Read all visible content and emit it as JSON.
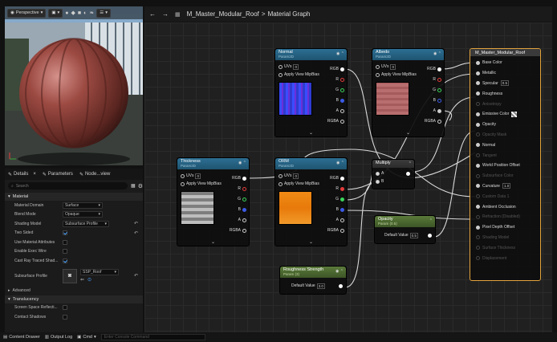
{
  "viewport": {
    "mode_label": "Perspective",
    "toolbar_icons": [
      "dropdown-icon",
      "camera-icon",
      "eye-icon",
      "pen-icon",
      "leaf-icon",
      "hamburger-icon"
    ]
  },
  "graph": {
    "breadcrumb_root": "M_Master_Modular_Roof",
    "breadcrumb_sep": ">",
    "breadcrumb_current": "Material Graph"
  },
  "details": {
    "tabs": [
      "Details",
      "Parameters",
      "Node...view"
    ],
    "search_placeholder": "Search",
    "sections": {
      "material": "Material",
      "advanced": "Advanced",
      "translucency": "Translucency"
    },
    "rows": [
      {
        "label": "Material Domain",
        "value": "Surface"
      },
      {
        "label": "Blend Mode",
        "value": "Opaque"
      },
      {
        "label": "Shading Model",
        "value": "Subsurface Profile"
      },
      {
        "label": "Two Sided"
      },
      {
        "label": "Use Material Attributes"
      },
      {
        "label": "Enable Exec Wire"
      },
      {
        "label": "Cast Ray Traced Shad..."
      },
      {
        "label": "Subsurface Profile",
        "value": "SSP_Roof"
      }
    ],
    "trans_rows": [
      "Screen Space Reflecti...",
      "Contact Shadows"
    ]
  },
  "bottom": {
    "content_drawer": "Content Drawer",
    "output_log": "Output Log",
    "cmd": "Cmd",
    "console_placeholder": "Enter Console Command"
  },
  "nodes": {
    "normal": {
      "title": "Normal",
      "sub": "Param2D",
      "uvs": "UVs",
      "uvs_val": "0",
      "mip": "Apply View MipBias",
      "pins": [
        "RGB",
        "R",
        "G",
        "B",
        "A",
        "RGBA"
      ]
    },
    "albedo": {
      "title": "Albedo",
      "sub": "Param2D",
      "uvs": "UVs",
      "uvs_val": "0",
      "mip": "Apply View MipBias",
      "pins": [
        "RGB",
        "R",
        "G",
        "B",
        "A",
        "RGBA"
      ]
    },
    "thickness": {
      "title": "Thickness",
      "sub": "Param2D",
      "uvs": "UVs",
      "uvs_val": "0",
      "mip": "Apply View MipBias",
      "pins": [
        "RGB",
        "R",
        "G",
        "B",
        "A",
        "RGBA"
      ]
    },
    "orm": {
      "title": "ORM",
      "sub": "Param2D",
      "uvs": "UVs",
      "uvs_val": "0",
      "mip": "Apply View MipBias",
      "pins": [
        "RGB",
        "R",
        "G",
        "B",
        "A",
        "RGBA"
      ]
    },
    "multiply": {
      "title": "Multiply",
      "a": "A",
      "b": "B"
    },
    "opacity": {
      "title": "Opacity",
      "sub": "Param (0.5)",
      "label": "Default Value",
      "value": "0.5"
    },
    "roughness": {
      "title": "Roughness Strength",
      "sub": "Param (3)",
      "label": "Default Value",
      "value": "3.0"
    }
  },
  "output_node": {
    "title": "M_Master_Modular_Roof",
    "pins": [
      {
        "label": "Base Color",
        "active": true
      },
      {
        "label": "Metallic",
        "active": true
      },
      {
        "label": "Specular",
        "active": true,
        "value": "0.5"
      },
      {
        "label": "Roughness",
        "active": true
      },
      {
        "label": "Anisotropy",
        "active": false
      },
      {
        "label": "Emissive Color",
        "active": true
      },
      {
        "label": "Opacity",
        "active": true
      },
      {
        "label": "Opacity Mask",
        "active": false
      },
      {
        "label": "Normal",
        "active": true
      },
      {
        "label": "Tangent",
        "active": false
      },
      {
        "label": "World Position Offset",
        "active": true
      },
      {
        "label": "Subsurface Color",
        "active": false
      },
      {
        "label": "Curvature",
        "active": true,
        "value": "1.0"
      },
      {
        "label": "Custom Data 1",
        "active": false
      },
      {
        "label": "Ambient Occlusion",
        "active": true
      },
      {
        "label": "Refraction (Disabled)",
        "active": false
      },
      {
        "label": "Pixel Depth Offset",
        "active": true
      },
      {
        "label": "Shading Model",
        "active": false
      },
      {
        "label": "Surface Thickness",
        "active": false
      },
      {
        "label": "Displacement",
        "active": false
      }
    ]
  },
  "colors": {
    "accent": "#e2a33c",
    "node_blue": "#2d6f93",
    "node_green": "#5a7a3a",
    "pin_red": "#e53b3b",
    "pin_green": "#3bd35a",
    "pin_blue": "#3b5be5"
  }
}
